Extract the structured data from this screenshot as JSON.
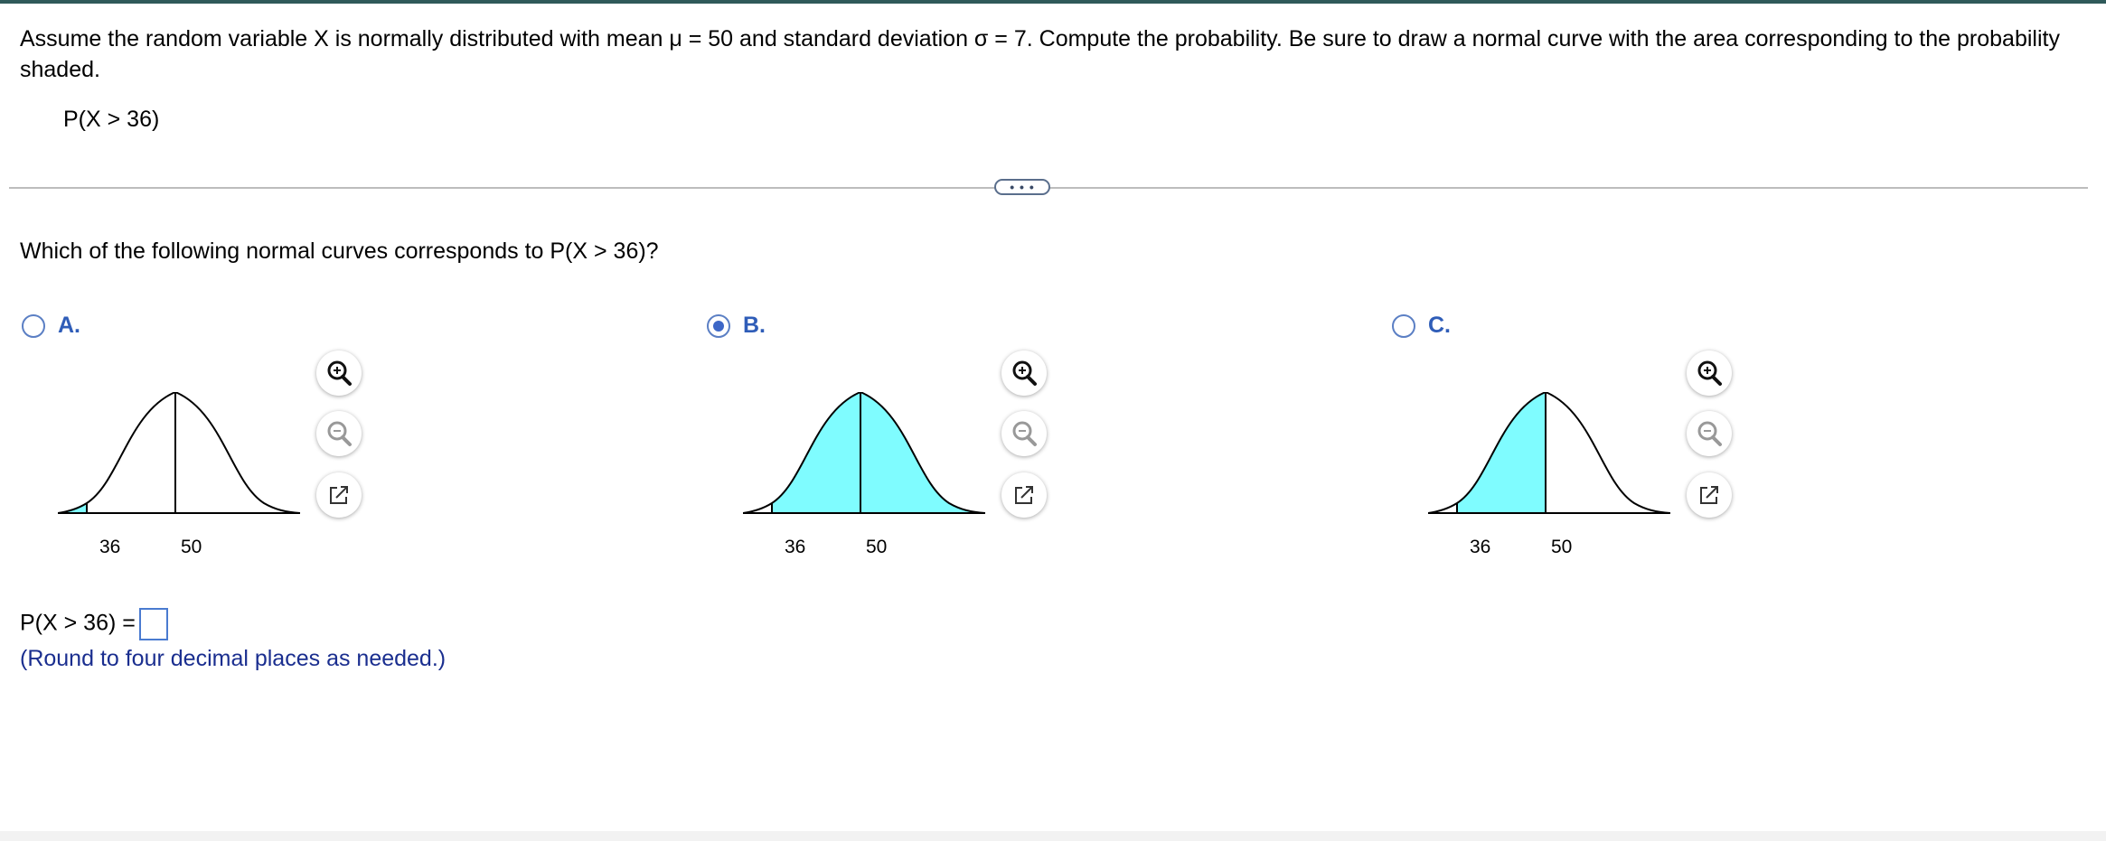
{
  "question": {
    "text": "Assume the random variable X is normally distributed with mean μ = 50 and standard deviation σ = 7. Compute the probability. Be sure to draw a normal curve with the area corresponding to the probability shaded.",
    "given": "P(X > 36)"
  },
  "more_button": "• • •",
  "prompt": "Which of the following normal curves corresponds to P(X > 36)?",
  "options": [
    {
      "letter": "A.",
      "selected": false,
      "tick_left": "36",
      "tick_right": "50",
      "shading": "left-tail"
    },
    {
      "letter": "B.",
      "selected": true,
      "tick_left": "36",
      "tick_right": "50",
      "shading": "right-of-36"
    },
    {
      "letter": "C.",
      "selected": false,
      "tick_left": "36",
      "tick_right": "50",
      "shading": "between-36-and-50"
    }
  ],
  "tools": [
    "zoom-in-icon",
    "zoom-out-icon",
    "popout-icon"
  ],
  "answer": {
    "label": "P(X > 36) =",
    "value": ""
  },
  "hint": "(Round to four decimal places as needed.)",
  "colors": {
    "shade": "#7ffcff",
    "accent": "#2f5db8",
    "topbar": "#2f5a5a"
  }
}
